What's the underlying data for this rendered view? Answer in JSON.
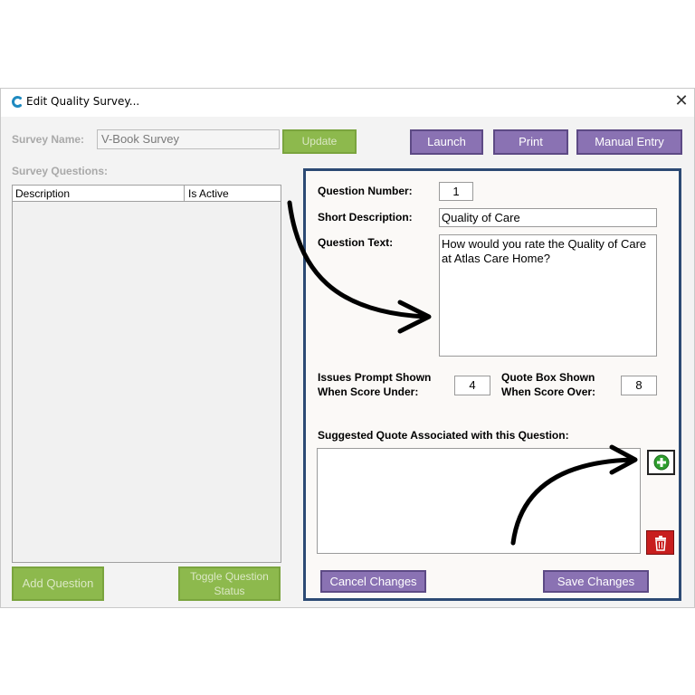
{
  "window": {
    "title": "Edit Quality Survey...",
    "close_glyph": "✕",
    "app_icon": "app-logo-icon"
  },
  "survey": {
    "name_label": "Survey Name:",
    "name_value": "V-Book Survey",
    "update_label": "Update",
    "questions_label": "Survey Questions:",
    "columns": [
      "Description",
      "Is Active"
    ],
    "add_question_label": "Add Question",
    "toggle_status_label": "Toggle Question Status"
  },
  "toolbar": {
    "launch_label": "Launch",
    "print_label": "Print",
    "manual_entry_label": "Manual Entry"
  },
  "question": {
    "number_label": "Question Number:",
    "number_value": "1",
    "short_desc_label": "Short Description:",
    "short_desc_value": "Quality of Care",
    "text_label": "Question Text:",
    "text_value": "How would you rate the Quality of Care at Atlas Care Home?",
    "issues_label_1": "Issues Prompt Shown",
    "issues_label_2": "When Score Under:",
    "issues_value": "4",
    "quote_label_1": "Quote Box Shown",
    "quote_label_2": "When Score Over:",
    "quote_value": "8",
    "suggested_quote_label": "Suggested Quote Associated with this Question:",
    "suggested_quote_value": "",
    "add_quote_icon": "add-icon",
    "delete_quote_icon": "trash-icon",
    "cancel_label": "Cancel Changes",
    "save_label": "Save Changes"
  },
  "colors": {
    "accent_purple": "#8a72b3",
    "accent_green": "#8db94d",
    "panel_border": "#2c4a74"
  }
}
